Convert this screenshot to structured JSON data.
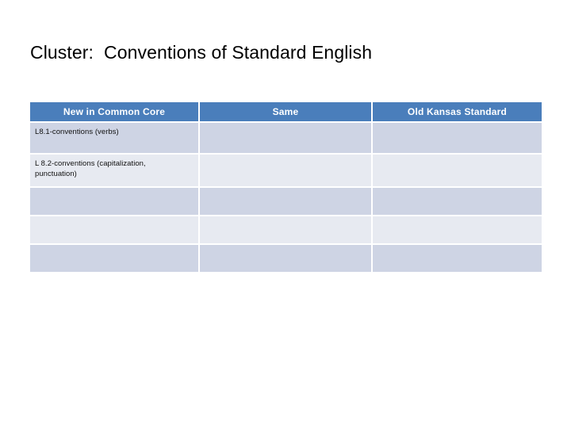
{
  "slide": {
    "title": "Cluster:  Conventions of Standard English"
  },
  "table": {
    "headers": [
      "New in Common Core",
      "Same",
      "Old Kansas Standard"
    ],
    "header_background": "#4a7ebb",
    "header_text_color": "#ffffff",
    "band_dark": "#ced4e4",
    "band_light": "#e7eaf1",
    "rows": [
      {
        "band": "dark",
        "cells": [
          {
            "lines": [
              "L8.1-conventions (verbs)"
            ]
          },
          {
            "lines": []
          },
          {
            "lines": []
          }
        ]
      },
      {
        "band": "light",
        "cells": [
          {
            "lines": [
              "L 8.2-conventions (capitalization,",
              "punctuation)"
            ]
          },
          {
            "lines": []
          },
          {
            "lines": []
          }
        ]
      },
      {
        "band": "dark",
        "cells": [
          {
            "lines": []
          },
          {
            "lines": []
          },
          {
            "lines": []
          }
        ]
      },
      {
        "band": "light",
        "cells": [
          {
            "lines": []
          },
          {
            "lines": []
          },
          {
            "lines": []
          }
        ]
      },
      {
        "band": "dark",
        "cells": [
          {
            "lines": []
          },
          {
            "lines": []
          },
          {
            "lines": []
          }
        ]
      }
    ]
  }
}
